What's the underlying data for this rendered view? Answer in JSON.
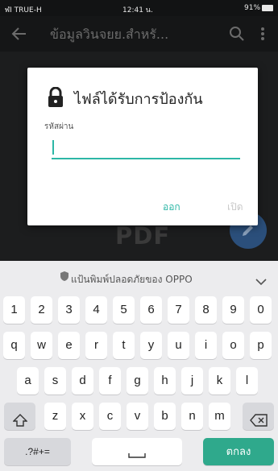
{
  "status_bar": {
    "carrier": "ฬI TRUE-H",
    "time": "12:41 น.",
    "battery": "91%"
  },
  "app_bar": {
    "title": "ข้อมูลวินจยย.สำหรั..."
  },
  "dialog": {
    "title": "ไฟล์ได้รับการป้องกัน",
    "field_label": "รหัสผ่าน",
    "password_value": "",
    "ok_label": "ออก",
    "open_label": "เปิด"
  },
  "document": {
    "logo_text": "PDF"
  },
  "keyboard": {
    "safe_typing_label": "แป้นพิมพ์ปลอดภัยของ OPPO",
    "row1": [
      "1",
      "2",
      "3",
      "4",
      "5",
      "6",
      "7",
      "8",
      "9",
      "0"
    ],
    "row2": [
      "q",
      "w",
      "e",
      "r",
      "t",
      "y",
      "u",
      "i",
      "o",
      "p"
    ],
    "row3": [
      "a",
      "s",
      "d",
      "f",
      "g",
      "h",
      "j",
      "k",
      "l"
    ],
    "row4": [
      "z",
      "x",
      "c",
      "v",
      "b",
      "n",
      "m"
    ],
    "symbols_label": ".?#+=",
    "enter_label": "ตกลง"
  },
  "icons": {
    "back": "arrow-left-icon",
    "search": "search-icon",
    "more": "more-vertical-icon",
    "lock": "lock-icon",
    "fab": "pencil-icon",
    "shield": "shield-icon",
    "collapse": "chevron-down-icon",
    "shift": "shift-icon",
    "backspace": "backspace-icon",
    "space": "space-icon"
  },
  "colors": {
    "accent": "#2db7a6",
    "enter_key": "#2fa98c",
    "fab": "#2b4f7b"
  }
}
